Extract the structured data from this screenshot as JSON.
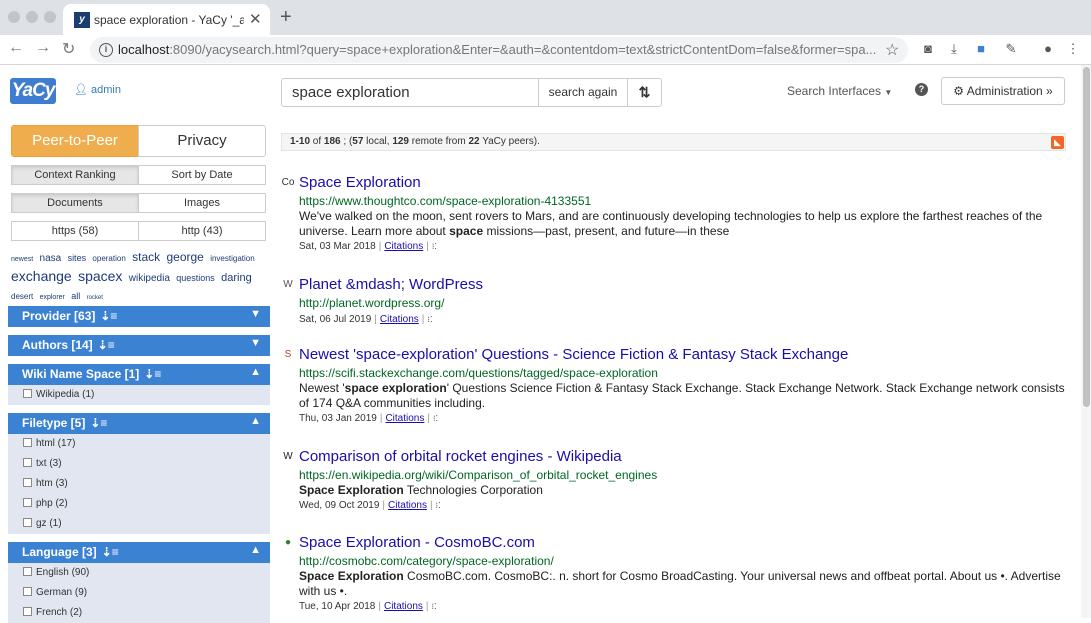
{
  "browser": {
    "tab_title": "space exploration - YaCy '_and",
    "tab_favicon": "y",
    "url_host": "localhost",
    "url_rest": ":8090/yacysearch.html?query=space+exploration&Enter=&auth=&contentdom=text&strictContentDom=false&former=spa..."
  },
  "header": {
    "logo": "YaCy",
    "admin_label": "admin",
    "search_value": "space exploration",
    "search_button": "search again",
    "interfaces": "Search Interfaces",
    "administration": "Administration »"
  },
  "sidebar": {
    "mode_p2p": "Peer-to-Peer",
    "mode_privacy": "Privacy",
    "context_ranking": "Context Ranking",
    "sort_by_date": "Sort by Date",
    "documents": "Documents",
    "images": "Images",
    "https": "https (58)",
    "http": "http (43)",
    "tags": [
      {
        "t": "newest",
        "s": 7
      },
      {
        "t": "nasa",
        "s": 10
      },
      {
        "t": "sites",
        "s": 9
      },
      {
        "t": "operation",
        "s": 8
      },
      {
        "t": "stack",
        "s": 12
      },
      {
        "t": "george",
        "s": 12
      },
      {
        "t": "investigation",
        "s": 8
      },
      {
        "t": "exchange",
        "s": 14
      },
      {
        "t": "spacex",
        "s": 14
      },
      {
        "t": "wikipedia",
        "s": 10
      },
      {
        "t": "questions",
        "s": 9
      },
      {
        "t": "daring",
        "s": 11
      },
      {
        "t": "desert",
        "s": 8
      },
      {
        "t": "explorer",
        "s": 7
      },
      {
        "t": "all",
        "s": 9
      },
      {
        "t": "rocket",
        "s": 6
      }
    ],
    "facets": [
      {
        "title": "Provider [63]",
        "open": false,
        "items": []
      },
      {
        "title": "Authors [14]",
        "open": false,
        "items": []
      },
      {
        "title": "Wiki Name Space [1]",
        "open": true,
        "items": [
          "Wikipedia (1)"
        ]
      },
      {
        "title": "Filetype [5]",
        "open": true,
        "items": [
          "html (17)",
          "txt (3)",
          "htm (3)",
          "php (2)",
          "gz (1)"
        ]
      },
      {
        "title": "Language [3]",
        "open": true,
        "items": [
          "English (90)",
          "German (9)",
          "French (2)"
        ]
      }
    ]
  },
  "results_info": {
    "range": "1-10",
    "total": "186",
    "local": "57",
    "remote": "129",
    "peers": "22"
  },
  "results": [
    {
      "title": "Space Exploration",
      "url": "https://www.thoughtco.com/space-exploration-4133551",
      "snippet_html": "We've walked on the moon, sent rovers to Mars, and are continuously developing technologies to help us explore the farthest reaches of the universe. Learn more about <b>space</b> missions—past, present, and future—in these",
      "date": "Sat, 03 Mar 2018",
      "citations": "Citations",
      "favicon": "Co"
    },
    {
      "title": "Planet &mdash; WordPress",
      "url": "http://planet.wordpress.org/",
      "snippet_html": "",
      "date": "Sat, 06 Jul 2019",
      "citations": "Citations",
      "favicon": "W"
    },
    {
      "title": "Newest 'space-exploration' Questions - Science Fiction & Fantasy Stack Exchange",
      "url": "https://scifi.stackexchange.com/questions/tagged/space-exploration",
      "snippet_html": "Newest '<b>space exploration</b>' Questions Science Fiction &amp; Fantasy Stack Exchange. Stack Exchange Network. Stack Exchange network consists of 174 Q&amp;A communities including.",
      "date": "Thu, 03 Jan 2019",
      "citations": "Citations",
      "favicon": "S"
    },
    {
      "title": "Comparison of orbital rocket engines - Wikipedia",
      "url": "https://en.wikipedia.org/wiki/Comparison_of_orbital_rocket_engines",
      "snippet_html": "<b>Space Exploration</b> Technologies Corporation",
      "date": "Wed, 09 Oct 2019",
      "citations": "Citations",
      "favicon": "W"
    },
    {
      "title": "Space Exploration - CosmoBC.com",
      "url": "http://cosmobc.com/category/space-exploration/",
      "snippet_html": "<b>Space Exploration</b> CosmoBC.com. CosmoBC:. n. short for Cosmo BroadCasting. Your universal news and offbeat portal. About us •. Advertise with us •.",
      "date": "Tue, 10 Apr 2018",
      "citations": "Citations",
      "favicon": "●"
    }
  ]
}
